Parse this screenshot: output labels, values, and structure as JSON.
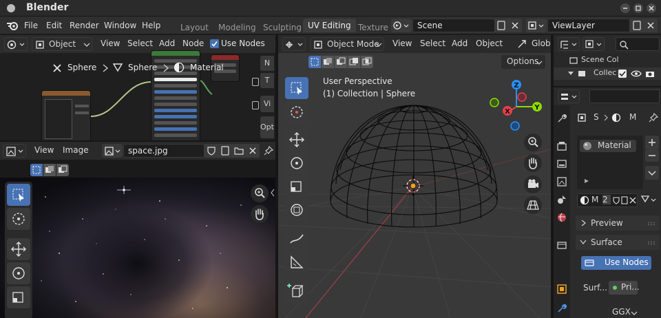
{
  "app": {
    "title": "Blender"
  },
  "menu": {
    "file": "File",
    "edit": "Edit",
    "render": "Render",
    "window": "Window",
    "help": "Help"
  },
  "workspaces": {
    "layout": "Layout",
    "modeling": "Modeling",
    "sculpting": "Sculpting",
    "uv_editing": "UV Editing",
    "texture": "Texture"
  },
  "scene": {
    "name": "Scene"
  },
  "view_layer": {
    "name": "ViewLayer"
  },
  "node_editor": {
    "object_type": "Object",
    "menus": {
      "view": "View",
      "select": "Select",
      "add": "Add",
      "node": "Node"
    },
    "use_nodes_label": "Use Nodes",
    "use_nodes_checked": true,
    "breadcrumb": {
      "item1": "Sphere",
      "item2": "Sphere",
      "item3": "Material"
    },
    "side_tabs": {
      "n": "N",
      "t": "T",
      "v": "Vi",
      "opt": "Opt"
    }
  },
  "image_editor": {
    "menus": {
      "view": "View",
      "image": "Image"
    },
    "image_name": "space.jpg"
  },
  "viewport": {
    "mode": "Object Mode",
    "menus": {
      "view": "View",
      "select": "Select",
      "add": "Add",
      "object": "Object"
    },
    "transform_orientation": "Glob",
    "options_label": "Options",
    "view_name": "User Perspective",
    "collection_info": "(1) Collection | Sphere",
    "gizmo_axes": {
      "x": "X",
      "y": "Y",
      "z": "Z"
    }
  },
  "outliner": {
    "row1": "Scene Col",
    "row2": "Collec"
  },
  "properties": {
    "object_short": "S",
    "material_short": "M",
    "material_slot": "Material",
    "material_name_short": "M",
    "user_count": "2",
    "preview_label": "Preview",
    "surface_label": "Surface",
    "use_nodes_button": "Use Nodes",
    "surface_field_label": "Surf...",
    "surface_value": "Pri...",
    "distribution": "GGX"
  },
  "colors": {
    "accent_blue": "#4772b3",
    "axis_x": "#e5404d",
    "axis_y": "#8bdc00",
    "axis_z": "#2890ff"
  }
}
